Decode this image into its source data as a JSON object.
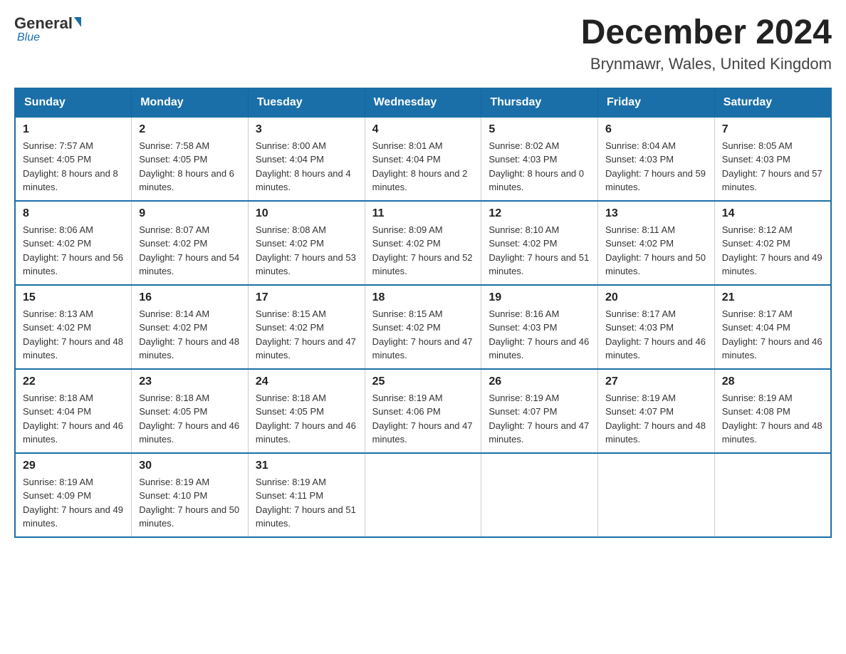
{
  "header": {
    "logo_general": "General",
    "logo_blue": "Blue",
    "month_title": "December 2024",
    "location": "Brynmawr, Wales, United Kingdom"
  },
  "weekdays": [
    "Sunday",
    "Monday",
    "Tuesday",
    "Wednesday",
    "Thursday",
    "Friday",
    "Saturday"
  ],
  "weeks": [
    [
      {
        "day": "1",
        "sunrise": "7:57 AM",
        "sunset": "4:05 PM",
        "daylight": "8 hours and 8 minutes."
      },
      {
        "day": "2",
        "sunrise": "7:58 AM",
        "sunset": "4:05 PM",
        "daylight": "8 hours and 6 minutes."
      },
      {
        "day": "3",
        "sunrise": "8:00 AM",
        "sunset": "4:04 PM",
        "daylight": "8 hours and 4 minutes."
      },
      {
        "day": "4",
        "sunrise": "8:01 AM",
        "sunset": "4:04 PM",
        "daylight": "8 hours and 2 minutes."
      },
      {
        "day": "5",
        "sunrise": "8:02 AM",
        "sunset": "4:03 PM",
        "daylight": "8 hours and 0 minutes."
      },
      {
        "day": "6",
        "sunrise": "8:04 AM",
        "sunset": "4:03 PM",
        "daylight": "7 hours and 59 minutes."
      },
      {
        "day": "7",
        "sunrise": "8:05 AM",
        "sunset": "4:03 PM",
        "daylight": "7 hours and 57 minutes."
      }
    ],
    [
      {
        "day": "8",
        "sunrise": "8:06 AM",
        "sunset": "4:02 PM",
        "daylight": "7 hours and 56 minutes."
      },
      {
        "day": "9",
        "sunrise": "8:07 AM",
        "sunset": "4:02 PM",
        "daylight": "7 hours and 54 minutes."
      },
      {
        "day": "10",
        "sunrise": "8:08 AM",
        "sunset": "4:02 PM",
        "daylight": "7 hours and 53 minutes."
      },
      {
        "day": "11",
        "sunrise": "8:09 AM",
        "sunset": "4:02 PM",
        "daylight": "7 hours and 52 minutes."
      },
      {
        "day": "12",
        "sunrise": "8:10 AM",
        "sunset": "4:02 PM",
        "daylight": "7 hours and 51 minutes."
      },
      {
        "day": "13",
        "sunrise": "8:11 AM",
        "sunset": "4:02 PM",
        "daylight": "7 hours and 50 minutes."
      },
      {
        "day": "14",
        "sunrise": "8:12 AM",
        "sunset": "4:02 PM",
        "daylight": "7 hours and 49 minutes."
      }
    ],
    [
      {
        "day": "15",
        "sunrise": "8:13 AM",
        "sunset": "4:02 PM",
        "daylight": "7 hours and 48 minutes."
      },
      {
        "day": "16",
        "sunrise": "8:14 AM",
        "sunset": "4:02 PM",
        "daylight": "7 hours and 48 minutes."
      },
      {
        "day": "17",
        "sunrise": "8:15 AM",
        "sunset": "4:02 PM",
        "daylight": "7 hours and 47 minutes."
      },
      {
        "day": "18",
        "sunrise": "8:15 AM",
        "sunset": "4:02 PM",
        "daylight": "7 hours and 47 minutes."
      },
      {
        "day": "19",
        "sunrise": "8:16 AM",
        "sunset": "4:03 PM",
        "daylight": "7 hours and 46 minutes."
      },
      {
        "day": "20",
        "sunrise": "8:17 AM",
        "sunset": "4:03 PM",
        "daylight": "7 hours and 46 minutes."
      },
      {
        "day": "21",
        "sunrise": "8:17 AM",
        "sunset": "4:04 PM",
        "daylight": "7 hours and 46 minutes."
      }
    ],
    [
      {
        "day": "22",
        "sunrise": "8:18 AM",
        "sunset": "4:04 PM",
        "daylight": "7 hours and 46 minutes."
      },
      {
        "day": "23",
        "sunrise": "8:18 AM",
        "sunset": "4:05 PM",
        "daylight": "7 hours and 46 minutes."
      },
      {
        "day": "24",
        "sunrise": "8:18 AM",
        "sunset": "4:05 PM",
        "daylight": "7 hours and 46 minutes."
      },
      {
        "day": "25",
        "sunrise": "8:19 AM",
        "sunset": "4:06 PM",
        "daylight": "7 hours and 47 minutes."
      },
      {
        "day": "26",
        "sunrise": "8:19 AM",
        "sunset": "4:07 PM",
        "daylight": "7 hours and 47 minutes."
      },
      {
        "day": "27",
        "sunrise": "8:19 AM",
        "sunset": "4:07 PM",
        "daylight": "7 hours and 48 minutes."
      },
      {
        "day": "28",
        "sunrise": "8:19 AM",
        "sunset": "4:08 PM",
        "daylight": "7 hours and 48 minutes."
      }
    ],
    [
      {
        "day": "29",
        "sunrise": "8:19 AM",
        "sunset": "4:09 PM",
        "daylight": "7 hours and 49 minutes."
      },
      {
        "day": "30",
        "sunrise": "8:19 AM",
        "sunset": "4:10 PM",
        "daylight": "7 hours and 50 minutes."
      },
      {
        "day": "31",
        "sunrise": "8:19 AM",
        "sunset": "4:11 PM",
        "daylight": "7 hours and 51 minutes."
      },
      null,
      null,
      null,
      null
    ]
  ]
}
